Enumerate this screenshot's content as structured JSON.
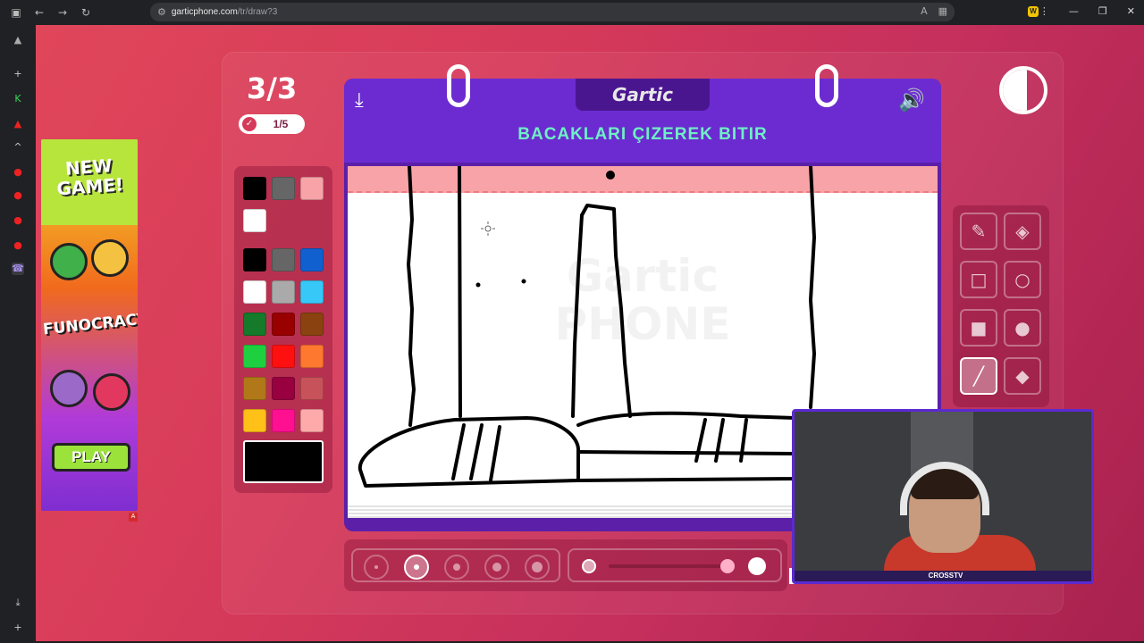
{
  "browser": {
    "url_host": "garticphone.com",
    "url_path": "/tr/draw?3"
  },
  "ad": {
    "title": "NEW GAME!",
    "brand": "FUNOCRACY",
    "play_label": "PLAY",
    "marker": "A"
  },
  "game": {
    "round": "3/3",
    "progress": "1/5",
    "logo": "Gartic",
    "prompt": "BACAKLARI ÇIZEREK BITIR",
    "watermark_line1": "Gartic",
    "watermark_line2": "PHONE"
  },
  "palette": {
    "top_colors": [
      "#000000",
      "#666666",
      "#f7a3a8",
      "#ffffff"
    ],
    "colors": [
      "#000000",
      "#666666",
      "#1060d0",
      "#ffffff",
      "#aaaaaa",
      "#38c8f8",
      "#157a2a",
      "#990000",
      "#8a4310",
      "#1ed040",
      "#ff1010",
      "#ff7830",
      "#b07818",
      "#990040",
      "#c8525a",
      "#ffc018",
      "#ff1090",
      "#ffaaaa"
    ],
    "current": "#000000"
  },
  "tools": [
    "pencil-icon",
    "eraser-icon",
    "square-outline-icon",
    "circle-outline-icon",
    "square-fill-icon",
    "circle-fill-icon",
    "line-icon",
    "bucket-icon"
  ],
  "brush_sizes": [
    1,
    2,
    3,
    4,
    5
  ],
  "brush_active_index": 1,
  "opacity_level": 0.95,
  "webcam": {
    "name": "CROSSTV"
  }
}
